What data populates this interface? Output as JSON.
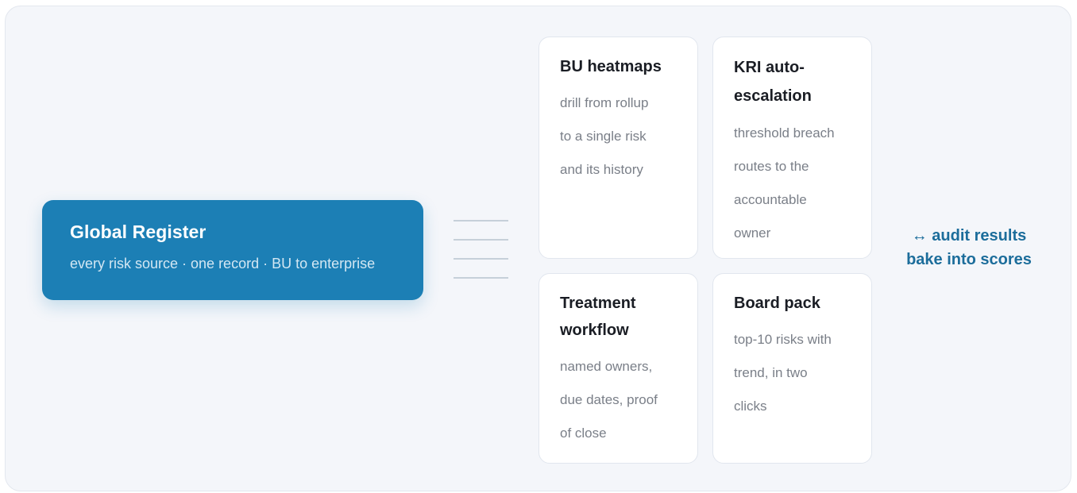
{
  "register": {
    "title": "Global Register",
    "subtitle": "every risk source · one record · BU to enterprise"
  },
  "cards": [
    {
      "title_lines": [
        "BU heatmaps"
      ],
      "body_lines": [
        "drill from rollup",
        "to a single risk",
        "and its history"
      ]
    },
    {
      "title_lines": [
        "KRI auto-",
        "escalation"
      ],
      "body_lines": [
        "threshold breach",
        "routes to the",
        "accountable",
        "owner"
      ]
    },
    {
      "title_lines": [
        "Treatment",
        "workflow"
      ],
      "body_lines": [
        "named owners,",
        "due dates, proof",
        "of close"
      ]
    },
    {
      "title_lines": [
        "Board pack"
      ],
      "body_lines": [
        "top-10 risks with",
        "trend, in two",
        "clicks"
      ]
    }
  ],
  "side_note": {
    "line1": "↔ audit results",
    "line2": "bake into scores"
  },
  "colors": {
    "register_bg": "#1c7fb5",
    "note_text": "#1c6d9b",
    "connector": "#c6d0d9"
  }
}
